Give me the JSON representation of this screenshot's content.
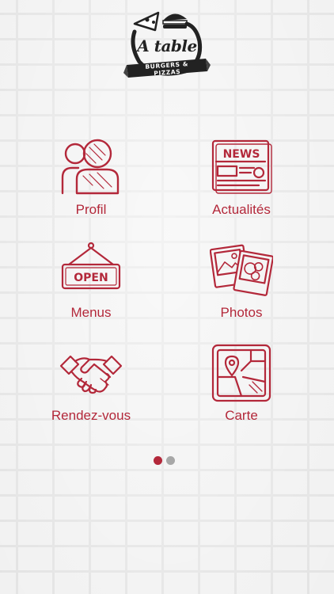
{
  "app": {
    "brand": "A table",
    "tagline": "BURGERS & PIZZAS"
  },
  "colors": {
    "accent": "#b3283a",
    "inactive_dot": "#a7a7a7",
    "background": "#f1f1f1"
  },
  "menu": {
    "items": [
      {
        "label": "Profil",
        "icon": "profile-icon"
      },
      {
        "label": "Actualités",
        "icon": "news-icon"
      },
      {
        "label": "Menus",
        "icon": "open-sign-icon"
      },
      {
        "label": "Photos",
        "icon": "photos-icon"
      },
      {
        "label": "Rendez-vous",
        "icon": "handshake-icon"
      },
      {
        "label": "Carte",
        "icon": "map-icon"
      }
    ],
    "news_icon_text": "NEWS",
    "open_sign_text": "OPEN"
  },
  "pager": {
    "pages": 2,
    "current": 1
  }
}
